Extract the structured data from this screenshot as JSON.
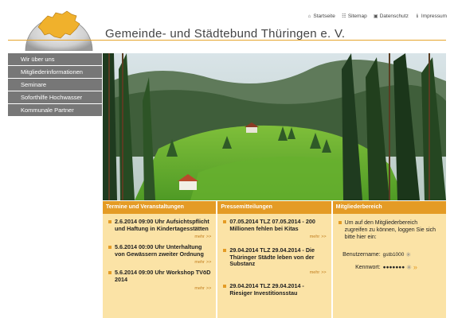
{
  "site": {
    "title": "Gemeinde- und Städtebund Thüringen e. V."
  },
  "topnav": [
    {
      "label": "Startseite",
      "icon": "home-icon"
    },
    {
      "label": "Sitemap",
      "icon": "sitemap-icon"
    },
    {
      "label": "Datenschutz",
      "icon": "privacy-icon"
    },
    {
      "label": "Impressum",
      "icon": "info-icon"
    }
  ],
  "sidebar": {
    "items": [
      {
        "label": "Wir über uns"
      },
      {
        "label": "Mitgliederinformationen"
      },
      {
        "label": "Seminare"
      },
      {
        "label": "Soforthilfe Hochwasser"
      },
      {
        "label": "Kommunale Partner"
      }
    ]
  },
  "columns": {
    "events": {
      "heading": "Termine und Veranstaltungen",
      "entries": [
        {
          "text": "2.6.2014 09:00 Uhr Aufsichtspflicht und Haftung in Kindertagesstätten",
          "more": "mehr"
        },
        {
          "text": "5.6.2014 00:00 Uhr Unterhaltung von Gewässern zweiter Ordnung",
          "more": "mehr"
        },
        {
          "text": "5.6.2014 09:00 Uhr Workshop TVöD 2014",
          "more": "mehr"
        }
      ]
    },
    "press": {
      "heading": "Pressemitteilungen",
      "entries": [
        {
          "text": "07.05.2014 TLZ 07.05.2014 - 200 Millionen fehlen bei Kitas",
          "more": "mehr"
        },
        {
          "text": "29.04.2014 TLZ 29.04.2014 - Die Thüringer Städte leben von der Substanz",
          "more": "mehr"
        },
        {
          "text": "29.04.2014 TLZ 29.04.2014 - Riesiger Investitionsstau",
          "more": ""
        }
      ]
    },
    "members": {
      "heading": "Mitgliederbereich",
      "intro": "Um auf den Mitgliederbereich zugreifen zu können, loggen Sie sich bitte hier ein:",
      "username_label": "Benutzername:",
      "username_value": "gstb1000",
      "password_label": "Kennwort:",
      "password_value": "●●●●●●●"
    }
  },
  "colors": {
    "accent": "#e49b25",
    "column_bg": "#fbe3a6",
    "nav_bg": "#777777"
  }
}
